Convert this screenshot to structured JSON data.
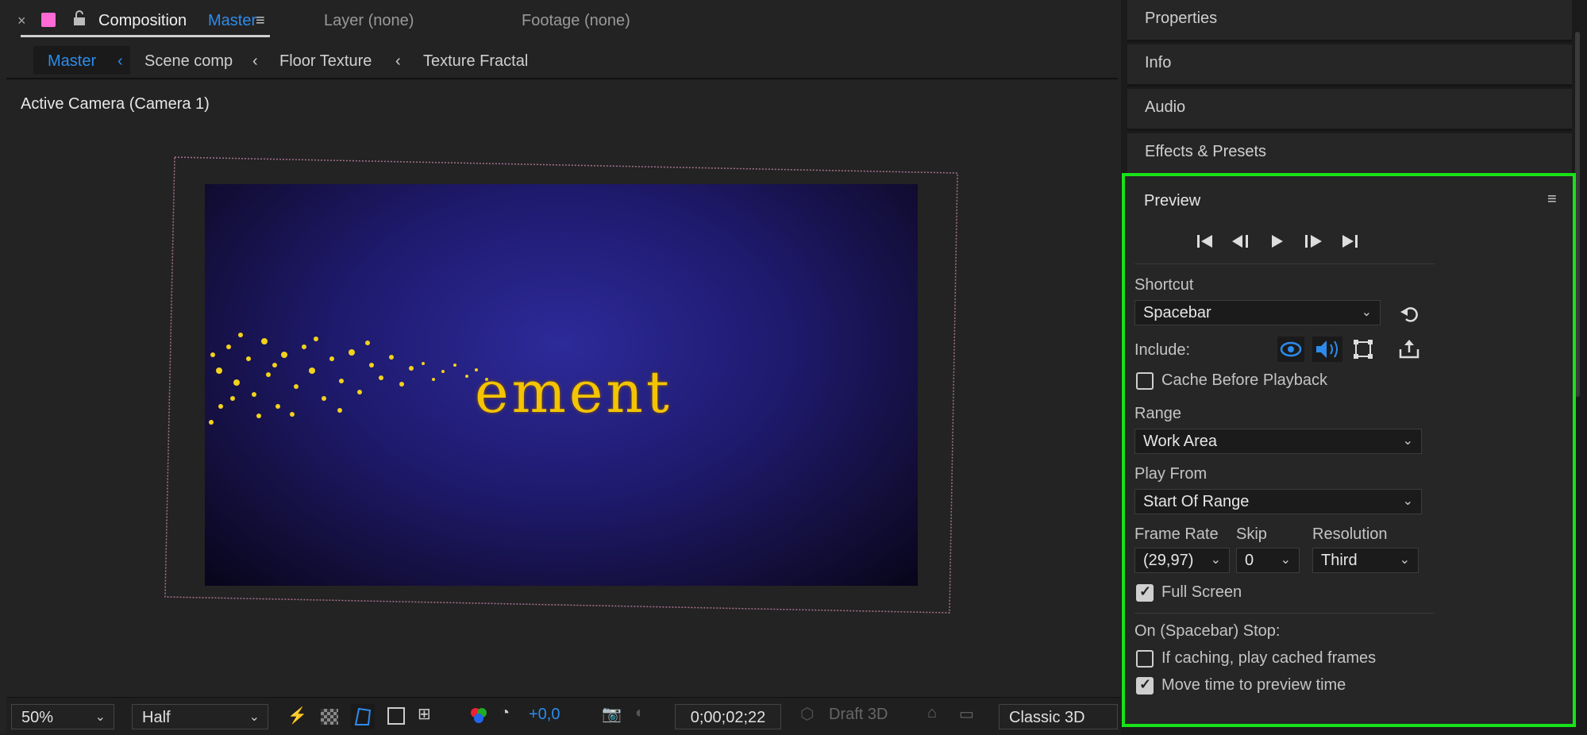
{
  "composition_tabbar": {
    "close": "×",
    "comp_prefix": "Composition",
    "comp_name": "Master",
    "layer_tab": "Layer (none)",
    "footage_tab": "Footage (none)"
  },
  "breadcrumbs": [
    "Master",
    "Scene comp",
    "Floor Texture",
    "Texture Fractal"
  ],
  "viewer": {
    "camera_label": "Active Camera (Camera 1)",
    "text_fragment": "ement"
  },
  "bottom_bar": {
    "zoom": "50%",
    "resolution": "Half",
    "exposure": "+0,0",
    "timecode": "0;00;02;22",
    "draft_3d": "Draft 3D",
    "renderer": "Classic 3D"
  },
  "side_panels": [
    "Properties",
    "Info",
    "Audio",
    "Effects & Presets"
  ],
  "preview": {
    "title": "Preview",
    "shortcut_label": "Shortcut",
    "shortcut_value": "Spacebar",
    "include_label": "Include:",
    "cache_before_playback": "Cache Before Playback",
    "range_label": "Range",
    "range_value": "Work Area",
    "play_from_label": "Play From",
    "play_from_value": "Start Of Range",
    "frame_rate_label": "Frame Rate",
    "frame_rate_value": "(29,97)",
    "skip_label": "Skip",
    "skip_value": "0",
    "resolution_label": "Resolution",
    "resolution_value": "Third",
    "full_screen": "Full Screen",
    "stop_label": "On (Spacebar) Stop:",
    "if_caching": "If caching, play cached frames",
    "move_time": "Move time to preview time",
    "checks": {
      "cache_before_playback": false,
      "full_screen": true,
      "if_caching": false,
      "move_time": true
    }
  },
  "colors": {
    "accent_blue": "#2d8ceb",
    "highlight_green": "#18e318",
    "comp_label_pink": "#ff6ad5"
  }
}
